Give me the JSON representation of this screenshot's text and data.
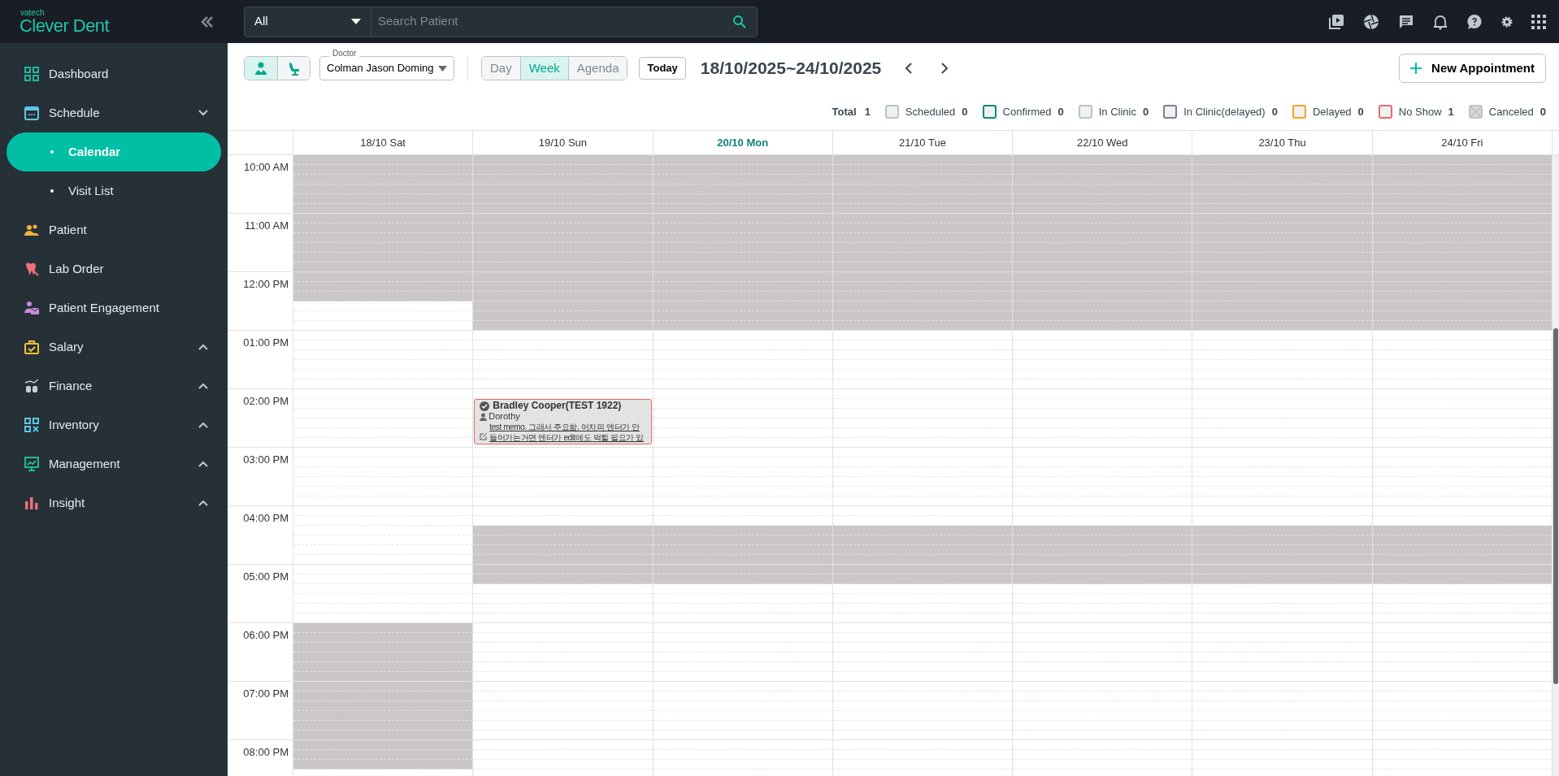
{
  "brand": {
    "maker": "vatech",
    "name": "Clever Dent"
  },
  "sidebar": {
    "items": [
      {
        "label": "Dashboard",
        "selected": false
      },
      {
        "label": "Schedule",
        "selected": false,
        "expanded": true,
        "children": [
          {
            "label": "Calendar",
            "selected": true
          },
          {
            "label": "Visit List",
            "selected": false
          }
        ]
      },
      {
        "label": "Patient",
        "selected": false
      },
      {
        "label": "Lab Order",
        "selected": false
      },
      {
        "label": "Patient Engagement",
        "selected": false
      },
      {
        "label": "Salary",
        "selected": false,
        "expanded": false
      },
      {
        "label": "Finance",
        "selected": false,
        "expanded": false
      },
      {
        "label": "Inventory",
        "selected": false,
        "expanded": false
      },
      {
        "label": "Management",
        "selected": false,
        "expanded": false
      },
      {
        "label": "Insight",
        "selected": false,
        "expanded": false
      }
    ]
  },
  "search": {
    "category": "All",
    "placeholder": "Search Patient"
  },
  "toolbar": {
    "resource_toggle": [
      {
        "selected": true
      },
      {
        "selected": false
      }
    ],
    "doctor": {
      "label": "Doctor",
      "value": "Colman Jason Doming"
    },
    "views": [
      {
        "label": "Day",
        "selected": false
      },
      {
        "label": "Week",
        "selected": true
      },
      {
        "label": "Agenda",
        "selected": false
      }
    ],
    "today": "Today",
    "range": "18/10/2025~24/10/2025",
    "new_appointment": "New Appointment"
  },
  "legend": {
    "total_label": "Total",
    "total": "1",
    "items": [
      {
        "label": "Scheduled",
        "count": "0",
        "color": "#b9c3ca"
      },
      {
        "label": "Confirmed",
        "count": "0",
        "color": "#138478"
      },
      {
        "label": "In Clinic",
        "count": "0",
        "color": "#b9c3ca"
      },
      {
        "label": "In Clinic(delayed)",
        "count": "0",
        "color": "#857a93"
      },
      {
        "label": "Delayed",
        "count": "0",
        "color": "#f0a51d"
      },
      {
        "label": "No Show",
        "count": "1",
        "color": "#e86a6a"
      },
      {
        "label": "Canceled",
        "count": "0",
        "color": "#c4c4c4",
        "kind": "crossed"
      }
    ]
  },
  "calendar": {
    "hours": [
      "10:00 AM",
      "11:00 AM",
      "12:00 PM",
      "01:00 PM",
      "02:00 PM",
      "03:00 PM",
      "04:00 PM",
      "05:00 PM",
      "06:00 PM",
      "07:00 PM",
      "08:00 PM"
    ],
    "days": [
      {
        "label": "18/10 Sat",
        "today": false,
        "slots": [
          {
            "closed": true
          },
          {
            "closed": true
          },
          {
            "closed": true
          },
          {
            "closed": true
          },
          {
            "closed": true
          },
          {
            "closed": true
          },
          {
            "closed": true
          },
          {
            "closed": true
          },
          {
            "closed": true
          },
          {
            "closed": true
          },
          {
            "closed": true
          },
          {
            "closed": true
          },
          {
            "closed": true
          },
          {
            "closed": true
          },
          {
            "closed": true
          },
          {
            "closed": false
          },
          {
            "closed": false
          },
          {
            "closed": false
          },
          {
            "closed": false
          },
          {
            "closed": false
          },
          {
            "closed": false
          },
          {
            "closed": false
          },
          {
            "closed": false
          },
          {
            "closed": false
          },
          {
            "closed": false
          },
          {
            "closed": false
          },
          {
            "closed": false
          },
          {
            "closed": false
          },
          {
            "closed": false
          },
          {
            "closed": false
          },
          {
            "closed": false
          },
          {
            "closed": false
          },
          {
            "closed": false
          },
          {
            "closed": false
          },
          {
            "closed": false
          },
          {
            "closed": false
          },
          {
            "closed": false
          },
          {
            "closed": false
          },
          {
            "closed": false
          },
          {
            "closed": false
          },
          {
            "closed": false
          },
          {
            "closed": false
          },
          {
            "closed": false
          },
          {
            "closed": false
          },
          {
            "closed": false
          },
          {
            "closed": false
          },
          {
            "closed": false
          },
          {
            "closed": false
          },
          {
            "closed": true
          },
          {
            "closed": true
          },
          {
            "closed": true
          },
          {
            "closed": true
          },
          {
            "closed": true
          },
          {
            "closed": true
          },
          {
            "closed": true
          },
          {
            "closed": true
          },
          {
            "closed": true
          },
          {
            "closed": true
          },
          {
            "closed": true
          },
          {
            "closed": true
          },
          {
            "closed": true
          },
          {
            "closed": true
          },
          {
            "closed": true
          }
        ]
      },
      {
        "label": "19/10 Sun",
        "today": false,
        "slots": [
          {
            "closed": true
          },
          {
            "closed": true
          },
          {
            "closed": true
          },
          {
            "closed": true
          },
          {
            "closed": true
          },
          {
            "closed": true
          },
          {
            "closed": true
          },
          {
            "closed": true
          },
          {
            "closed": true
          },
          {
            "closed": true
          },
          {
            "closed": true
          },
          {
            "closed": true
          },
          {
            "closed": true
          },
          {
            "closed": true
          },
          {
            "closed": true
          },
          {
            "closed": true
          },
          {
            "closed": true
          },
          {
            "closed": true
          },
          {
            "closed": false
          },
          {
            "closed": false
          },
          {
            "closed": false
          },
          {
            "closed": false
          },
          {
            "closed": false
          },
          {
            "closed": false
          },
          {
            "closed": false
          },
          {
            "closed": false,
            "appointments": [
              {
                "color": "#e86a6a",
                "patient": "Bradley Cooper(TEST 1922)",
                "staff": "Dorothy",
                "memo": [
                  "test memo. 그래서 주요함. 어차피 엔터가 안",
                  "들어가는거면 엔터가 edit에도 먹힐 필요가 있"
                ]
              }
            ]
          },
          {
            "closed": false
          },
          {
            "closed": false
          },
          {
            "closed": false
          },
          {
            "closed": false
          },
          {
            "closed": false
          },
          {
            "closed": false
          },
          {
            "closed": false
          },
          {
            "closed": false
          },
          {
            "closed": false
          },
          {
            "closed": false
          },
          {
            "closed": false
          },
          {
            "closed": false
          },
          {
            "closed": true
          },
          {
            "closed": true
          },
          {
            "closed": true
          },
          {
            "closed": true
          },
          {
            "closed": true
          },
          {
            "closed": true
          },
          {
            "closed": false
          },
          {
            "closed": false
          },
          {
            "closed": false
          },
          {
            "closed": false
          },
          {
            "closed": false
          },
          {
            "closed": false
          },
          {
            "closed": false
          },
          {
            "closed": false
          },
          {
            "closed": false
          },
          {
            "closed": false
          },
          {
            "closed": false
          },
          {
            "closed": false
          },
          {
            "closed": false
          },
          {
            "closed": false
          },
          {
            "closed": false
          },
          {
            "closed": false
          },
          {
            "closed": false
          },
          {
            "closed": false
          },
          {
            "closed": false
          }
        ]
      },
      {
        "label": "20/10 Mon",
        "today": true,
        "slots": [
          {
            "closed": true
          },
          {
            "closed": true
          },
          {
            "closed": true
          },
          {
            "closed": true
          },
          {
            "closed": true
          },
          {
            "closed": true
          },
          {
            "closed": true
          },
          {
            "closed": true
          },
          {
            "closed": true
          },
          {
            "closed": true
          },
          {
            "closed": true
          },
          {
            "closed": true
          },
          {
            "closed": true
          },
          {
            "closed": true
          },
          {
            "closed": true
          },
          {
            "closed": true
          },
          {
            "closed": true
          },
          {
            "closed": true
          },
          {
            "closed": false
          },
          {
            "closed": false
          },
          {
            "closed": false
          },
          {
            "closed": false
          },
          {
            "closed": false
          },
          {
            "closed": false
          },
          {
            "closed": false
          },
          {
            "closed": false
          },
          {
            "closed": false
          },
          {
            "closed": false
          },
          {
            "closed": false
          },
          {
            "closed": false
          },
          {
            "closed": false
          },
          {
            "closed": false
          },
          {
            "closed": false
          },
          {
            "closed": false
          },
          {
            "closed": false
          },
          {
            "closed": false
          },
          {
            "closed": false
          },
          {
            "closed": false
          },
          {
            "closed": true
          },
          {
            "closed": true
          },
          {
            "closed": true
          },
          {
            "closed": true
          },
          {
            "closed": true
          },
          {
            "closed": true
          },
          {
            "closed": false
          },
          {
            "closed": false
          },
          {
            "closed": false
          },
          {
            "closed": false
          },
          {
            "closed": false
          },
          {
            "closed": false
          },
          {
            "closed": false
          },
          {
            "closed": false
          },
          {
            "closed": false
          },
          {
            "closed": false
          },
          {
            "closed": false
          },
          {
            "closed": false
          },
          {
            "closed": false
          },
          {
            "closed": false
          },
          {
            "closed": false
          },
          {
            "closed": false
          },
          {
            "closed": false
          },
          {
            "closed": false
          },
          {
            "closed": false
          }
        ]
      },
      {
        "label": "21/10 Tue",
        "today": false,
        "slots": [
          {
            "closed": true
          },
          {
            "closed": true
          },
          {
            "closed": true
          },
          {
            "closed": true
          },
          {
            "closed": true
          },
          {
            "closed": true
          },
          {
            "closed": true
          },
          {
            "closed": true
          },
          {
            "closed": true
          },
          {
            "closed": true
          },
          {
            "closed": true
          },
          {
            "closed": true
          },
          {
            "closed": true
          },
          {
            "closed": true
          },
          {
            "closed": true
          },
          {
            "closed": true
          },
          {
            "closed": true
          },
          {
            "closed": true
          },
          {
            "closed": false
          },
          {
            "closed": false
          },
          {
            "closed": false
          },
          {
            "closed": false
          },
          {
            "closed": false
          },
          {
            "closed": false
          },
          {
            "closed": false
          },
          {
            "closed": false
          },
          {
            "closed": false
          },
          {
            "closed": false
          },
          {
            "closed": false
          },
          {
            "closed": false
          },
          {
            "closed": false
          },
          {
            "closed": false
          },
          {
            "closed": false
          },
          {
            "closed": false
          },
          {
            "closed": false
          },
          {
            "closed": false
          },
          {
            "closed": false
          },
          {
            "closed": false
          },
          {
            "closed": true
          },
          {
            "closed": true
          },
          {
            "closed": true
          },
          {
            "closed": true
          },
          {
            "closed": true
          },
          {
            "closed": true
          },
          {
            "closed": false
          },
          {
            "closed": false
          },
          {
            "closed": false
          },
          {
            "closed": false
          },
          {
            "closed": false
          },
          {
            "closed": false
          },
          {
            "closed": false
          },
          {
            "closed": false
          },
          {
            "closed": false
          },
          {
            "closed": false
          },
          {
            "closed": false
          },
          {
            "closed": false
          },
          {
            "closed": false
          },
          {
            "closed": false
          },
          {
            "closed": false
          },
          {
            "closed": false
          },
          {
            "closed": false
          },
          {
            "closed": false
          },
          {
            "closed": false
          }
        ]
      },
      {
        "label": "22/10 Wed",
        "today": false,
        "slots": [
          {
            "closed": true
          },
          {
            "closed": true
          },
          {
            "closed": true
          },
          {
            "closed": true
          },
          {
            "closed": true
          },
          {
            "closed": true
          },
          {
            "closed": true
          },
          {
            "closed": true
          },
          {
            "closed": true
          },
          {
            "closed": true
          },
          {
            "closed": true
          },
          {
            "closed": true
          },
          {
            "closed": true
          },
          {
            "closed": true
          },
          {
            "closed": true
          },
          {
            "closed": true
          },
          {
            "closed": true
          },
          {
            "closed": true
          },
          {
            "closed": false
          },
          {
            "closed": false
          },
          {
            "closed": false
          },
          {
            "closed": false
          },
          {
            "closed": false
          },
          {
            "closed": false
          },
          {
            "closed": false
          },
          {
            "closed": false
          },
          {
            "closed": false
          },
          {
            "closed": false
          },
          {
            "closed": false
          },
          {
            "closed": false
          },
          {
            "closed": false
          },
          {
            "closed": false
          },
          {
            "closed": false
          },
          {
            "closed": false
          },
          {
            "closed": false
          },
          {
            "closed": false
          },
          {
            "closed": false
          },
          {
            "closed": false
          },
          {
            "closed": true
          },
          {
            "closed": true
          },
          {
            "closed": true
          },
          {
            "closed": true
          },
          {
            "closed": true
          },
          {
            "closed": true
          },
          {
            "closed": false
          },
          {
            "closed": false
          },
          {
            "closed": false
          },
          {
            "closed": false
          },
          {
            "closed": false
          },
          {
            "closed": false
          },
          {
            "closed": false
          },
          {
            "closed": false
          },
          {
            "closed": false
          },
          {
            "closed": false
          },
          {
            "closed": false
          },
          {
            "closed": false
          },
          {
            "closed": false
          },
          {
            "closed": false
          },
          {
            "closed": false
          },
          {
            "closed": false
          },
          {
            "closed": false
          },
          {
            "closed": false
          },
          {
            "closed": false
          }
        ]
      },
      {
        "label": "23/10 Thu",
        "today": false,
        "slots": [
          {
            "closed": true
          },
          {
            "closed": true
          },
          {
            "closed": true
          },
          {
            "closed": true
          },
          {
            "closed": true
          },
          {
            "closed": true
          },
          {
            "closed": true
          },
          {
            "closed": true
          },
          {
            "closed": true
          },
          {
            "closed": true
          },
          {
            "closed": true
          },
          {
            "closed": true
          },
          {
            "closed": true
          },
          {
            "closed": true
          },
          {
            "closed": true
          },
          {
            "closed": true
          },
          {
            "closed": true
          },
          {
            "closed": true
          },
          {
            "closed": false
          },
          {
            "closed": false
          },
          {
            "closed": false
          },
          {
            "closed": false
          },
          {
            "closed": false
          },
          {
            "closed": false
          },
          {
            "closed": false
          },
          {
            "closed": false
          },
          {
            "closed": false
          },
          {
            "closed": false
          },
          {
            "closed": false
          },
          {
            "closed": false
          },
          {
            "closed": false
          },
          {
            "closed": false
          },
          {
            "closed": false
          },
          {
            "closed": false
          },
          {
            "closed": false
          },
          {
            "closed": false
          },
          {
            "closed": false
          },
          {
            "closed": false
          },
          {
            "closed": true
          },
          {
            "closed": true
          },
          {
            "closed": true
          },
          {
            "closed": true
          },
          {
            "closed": true
          },
          {
            "closed": true
          },
          {
            "closed": false
          },
          {
            "closed": false
          },
          {
            "closed": false
          },
          {
            "closed": false
          },
          {
            "closed": false
          },
          {
            "closed": false
          },
          {
            "closed": false
          },
          {
            "closed": false
          },
          {
            "closed": false
          },
          {
            "closed": false
          },
          {
            "closed": false
          },
          {
            "closed": false
          },
          {
            "closed": false
          },
          {
            "closed": false
          },
          {
            "closed": false
          },
          {
            "closed": false
          },
          {
            "closed": false
          },
          {
            "closed": false
          },
          {
            "closed": false
          }
        ]
      },
      {
        "label": "24/10 Fri",
        "today": false,
        "slots": [
          {
            "closed": true
          },
          {
            "closed": true
          },
          {
            "closed": true
          },
          {
            "closed": true
          },
          {
            "closed": true
          },
          {
            "closed": true
          },
          {
            "closed": true
          },
          {
            "closed": true
          },
          {
            "closed": true
          },
          {
            "closed": true
          },
          {
            "closed": true
          },
          {
            "closed": true
          },
          {
            "closed": true
          },
          {
            "closed": true
          },
          {
            "closed": true
          },
          {
            "closed": true
          },
          {
            "closed": true
          },
          {
            "closed": true
          },
          {
            "closed": false
          },
          {
            "closed": false
          },
          {
            "closed": false
          },
          {
            "closed": false
          },
          {
            "closed": false
          },
          {
            "closed": false
          },
          {
            "closed": false
          },
          {
            "closed": false
          },
          {
            "closed": false
          },
          {
            "closed": false
          },
          {
            "closed": false
          },
          {
            "closed": false
          },
          {
            "closed": false
          },
          {
            "closed": false
          },
          {
            "closed": false
          },
          {
            "closed": false
          },
          {
            "closed": false
          },
          {
            "closed": false
          },
          {
            "closed": false
          },
          {
            "closed": false
          },
          {
            "closed": true
          },
          {
            "closed": true
          },
          {
            "closed": true
          },
          {
            "closed": true
          },
          {
            "closed": true
          },
          {
            "closed": true
          },
          {
            "closed": false
          },
          {
            "closed": false
          },
          {
            "closed": false
          },
          {
            "closed": false
          },
          {
            "closed": false
          },
          {
            "closed": false
          },
          {
            "closed": false
          },
          {
            "closed": false
          },
          {
            "closed": false
          },
          {
            "closed": false
          },
          {
            "closed": false
          },
          {
            "closed": false
          },
          {
            "closed": false
          },
          {
            "closed": false
          },
          {
            "closed": false
          },
          {
            "closed": false
          },
          {
            "closed": false
          },
          {
            "closed": false
          },
          {
            "closed": false
          }
        ]
      }
    ]
  }
}
